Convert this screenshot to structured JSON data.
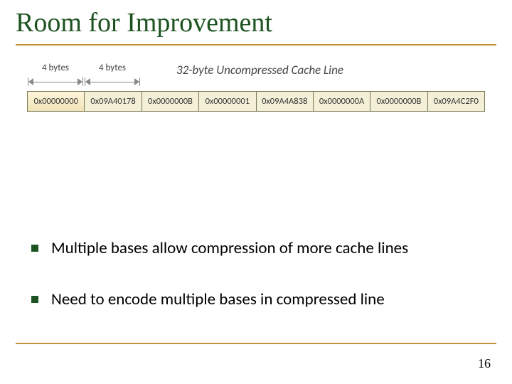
{
  "title": "Room for Improvement",
  "diagram": {
    "dim1": "4 bytes",
    "dim2": "4 bytes",
    "heading": "32-byte Uncompressed Cache Line",
    "cells": [
      "0x00000000",
      "0x09A40178",
      "0x0000000B",
      "0x00000001",
      "0x09A4A838",
      "0x0000000A",
      "0x0000000B",
      "0x09A4C2F0"
    ]
  },
  "bullets": [
    "Multiple bases allow compression of more cache lines",
    "Need to encode multiple bases in compressed line"
  ],
  "page": "16"
}
